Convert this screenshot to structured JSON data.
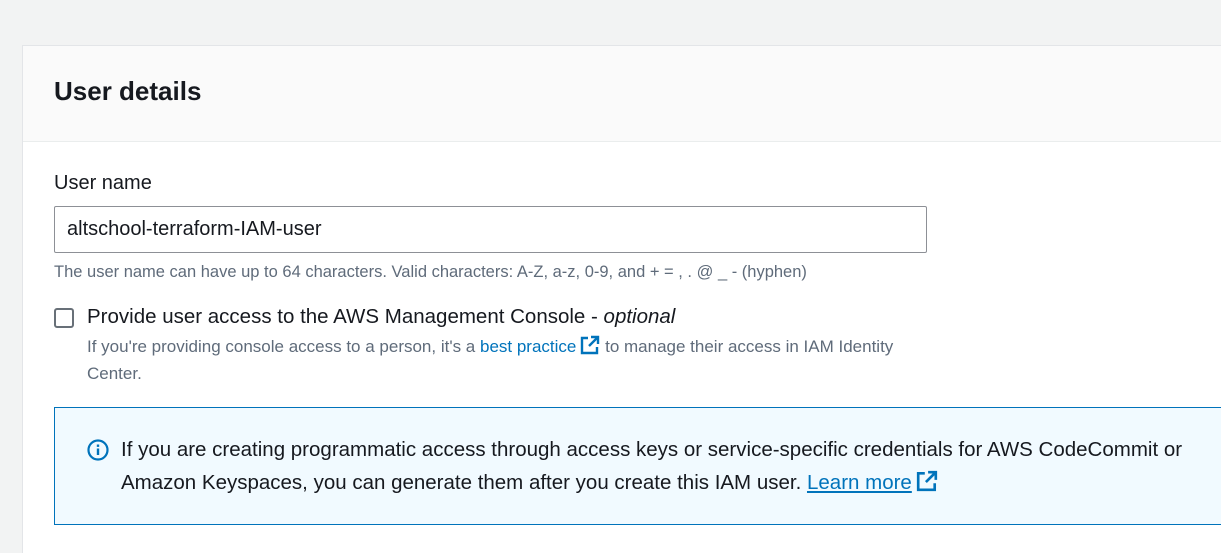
{
  "panel": {
    "title": "User details"
  },
  "user_name": {
    "label": "User name",
    "value": "altschool-terraform-IAM-user",
    "constraint": "The user name can have up to 64 characters. Valid characters: A-Z, a-z, 0-9, and + = , . @ _ - (hyphen)"
  },
  "console_access": {
    "label": "Provide user access to the AWS Management Console - ",
    "label_optional": "optional",
    "checked": false,
    "desc_before": "If you're providing console access to a person, it's a ",
    "desc_link": "best practice",
    "desc_after": " to manage their access in IAM Identity Center."
  },
  "info": {
    "text": "If you are creating programmatic access through access keys or service-specific credentials for AWS CodeCommit or Amazon Keyspaces, you can generate them after you create this IAM user. ",
    "link": "Learn more"
  },
  "colors": {
    "link": "#0073bb",
    "info_bg": "#f1faff",
    "info_border": "#0073bb"
  },
  "icons": {
    "external": "external-link-icon",
    "info": "info-icon"
  }
}
